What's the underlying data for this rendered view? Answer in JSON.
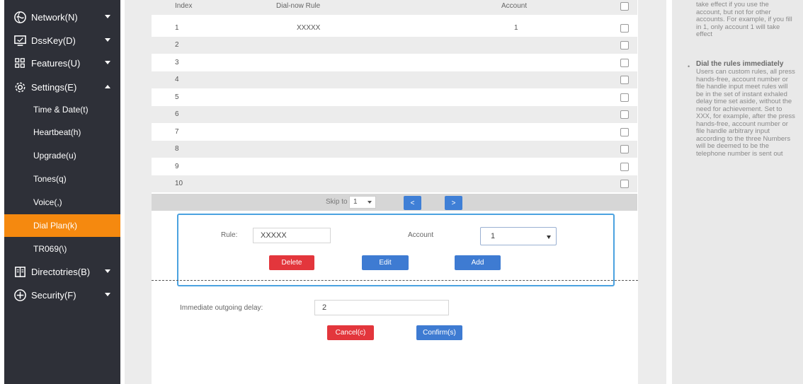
{
  "sidebar": {
    "network": "Network(N)",
    "dsskey": "DssKey(D)",
    "features": "Features(U)",
    "settings": "Settings(E)",
    "settings_items": [
      "Time & Date(t)",
      "Heartbeat(h)",
      "Upgrade(u)",
      "Tones(q)",
      "Voice(,)",
      "Dial Plan(k)",
      "TR069(\\)"
    ],
    "active_item": "Dial Plan(k)",
    "directories": "Directotries(B)",
    "security": "Security(F)"
  },
  "table": {
    "headers": {
      "index": "Index",
      "rule": "Dial-now Rule",
      "account": "Account"
    },
    "rows": [
      {
        "index": "1",
        "rule": "XXXXX",
        "account": "1"
      },
      {
        "index": "2",
        "rule": "",
        "account": ""
      },
      {
        "index": "3",
        "rule": "",
        "account": ""
      },
      {
        "index": "4",
        "rule": "",
        "account": ""
      },
      {
        "index": "5",
        "rule": "",
        "account": ""
      },
      {
        "index": "6",
        "rule": "",
        "account": ""
      },
      {
        "index": "7",
        "rule": "",
        "account": ""
      },
      {
        "index": "8",
        "rule": "",
        "account": ""
      },
      {
        "index": "9",
        "rule": "",
        "account": ""
      },
      {
        "index": "10",
        "rule": "",
        "account": ""
      }
    ]
  },
  "pager": {
    "skip_label": "Skip to",
    "page_value": "1",
    "prev_label": "<",
    "next_label": ">"
  },
  "edit": {
    "rule_label": "Rule:",
    "rule_value": "XXXXX",
    "account_label": "Account",
    "account_value": "1",
    "delete_label": "Delete",
    "edit_label": "Edit",
    "add_label": "Add"
  },
  "delay": {
    "label": "Immediate outgoing delay:",
    "value": "2",
    "cancel_label": "Cancel(c)",
    "confirm_label": "Confirm(s)"
  },
  "help": {
    "intro": "take effect if you use the account, but not for other accounts. For example, if you fill in 1, only account 1 will take effect",
    "title": "Dial the rules immediately",
    "body": "Users can custom rules, all press hands-free, account number or file handle input meet rules will be in the set of instant exhaled delay time set aside, without the need for achievement. Set to XXX, for example, after the press hands-free, account number or file handle arbitrary input according to the three Numbers will be deemed to be the telephone number is sent out"
  },
  "colors": {
    "sidebar_bg": "#2e3038",
    "active_orange": "#f5890f",
    "button_blue": "#3e7bd2",
    "button_red": "#e3363c",
    "focus_border": "#4ba2e0"
  }
}
